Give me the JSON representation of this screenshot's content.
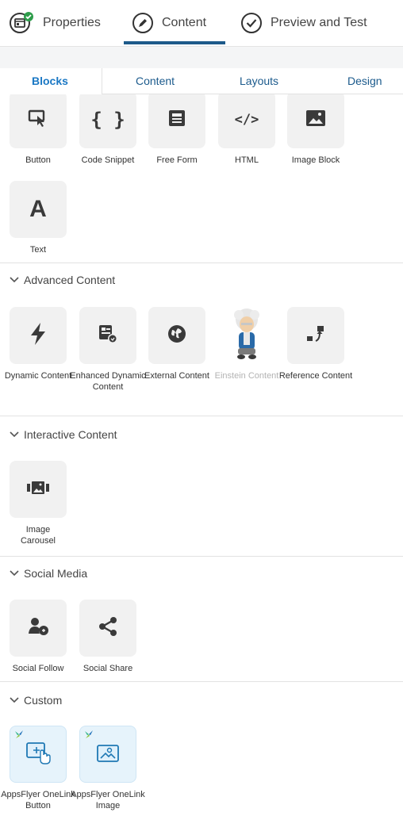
{
  "top_tabs": [
    {
      "label": "Properties",
      "icon": "properties-check-icon"
    },
    {
      "label": "Content",
      "icon": "pencil-circle-icon"
    },
    {
      "label": "Preview and Test",
      "icon": "check-circle-icon"
    }
  ],
  "sub_tabs": [
    "Blocks",
    "Content",
    "Layouts",
    "Design"
  ],
  "basic_blocks": [
    {
      "label": "Button",
      "icon": "button-cursor-icon"
    },
    {
      "label": "Code Snippet",
      "icon": "braces-icon"
    },
    {
      "label": "Free Form",
      "icon": "free-form-icon"
    },
    {
      "label": "HTML",
      "icon": "html-code-icon"
    },
    {
      "label": "Image Block",
      "icon": "image-icon"
    },
    {
      "label": "Text",
      "icon": "text-a-icon"
    }
  ],
  "sections": {
    "advanced": {
      "title": "Advanced Content",
      "items": [
        "Dynamic Content",
        "Enhanced Dynamic Content",
        "External Content",
        "Einstein Content",
        "Reference Content"
      ]
    },
    "interactive": {
      "title": "Interactive Content",
      "items": [
        "Image Carousel"
      ]
    },
    "social": {
      "title": "Social Media",
      "items": [
        "Social Follow",
        "Social Share"
      ]
    },
    "custom": {
      "title": "Custom",
      "items": [
        "AppsFlyer OneLink Button",
        "AppsFlyer OneLink Image"
      ]
    }
  },
  "colors": {
    "accent": "#1b78c4",
    "underline": "#1d5a8a",
    "tile_bg": "#f1f1f1",
    "icon": "#3a3a3a"
  }
}
